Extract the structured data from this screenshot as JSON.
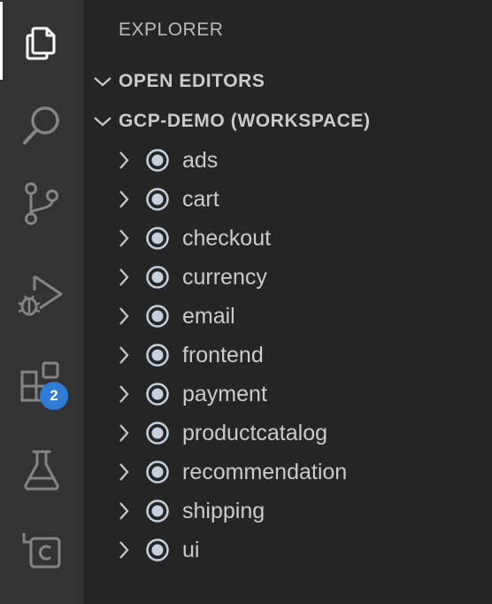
{
  "activity_bar": {
    "items": [
      {
        "name": "explorer-icon",
        "active": true
      },
      {
        "name": "search-icon",
        "active": false
      },
      {
        "name": "source-control-icon",
        "active": false
      },
      {
        "name": "run-debug-icon",
        "active": false
      },
      {
        "name": "extensions-icon",
        "active": false
      },
      {
        "name": "testing-icon",
        "active": false
      },
      {
        "name": "remote-explorer-icon",
        "active": false
      }
    ],
    "extensions_badge": "2"
  },
  "sidebar": {
    "title": "EXPLORER",
    "sections": {
      "open_editors": "OPEN EDITORS",
      "workspace": "GCP-DEMO (WORKSPACE)"
    },
    "folders": [
      {
        "name": "ads"
      },
      {
        "name": "cart"
      },
      {
        "name": "checkout"
      },
      {
        "name": "currency"
      },
      {
        "name": "email"
      },
      {
        "name": "frontend"
      },
      {
        "name": "payment"
      },
      {
        "name": "productcatalog"
      },
      {
        "name": "recommendation"
      },
      {
        "name": "shipping"
      },
      {
        "name": "ui"
      }
    ]
  },
  "colors": {
    "activity_bar_bg": "#333333",
    "sidebar_bg": "#252526",
    "text": "#cccccc",
    "badge": "#2f7bd6"
  }
}
